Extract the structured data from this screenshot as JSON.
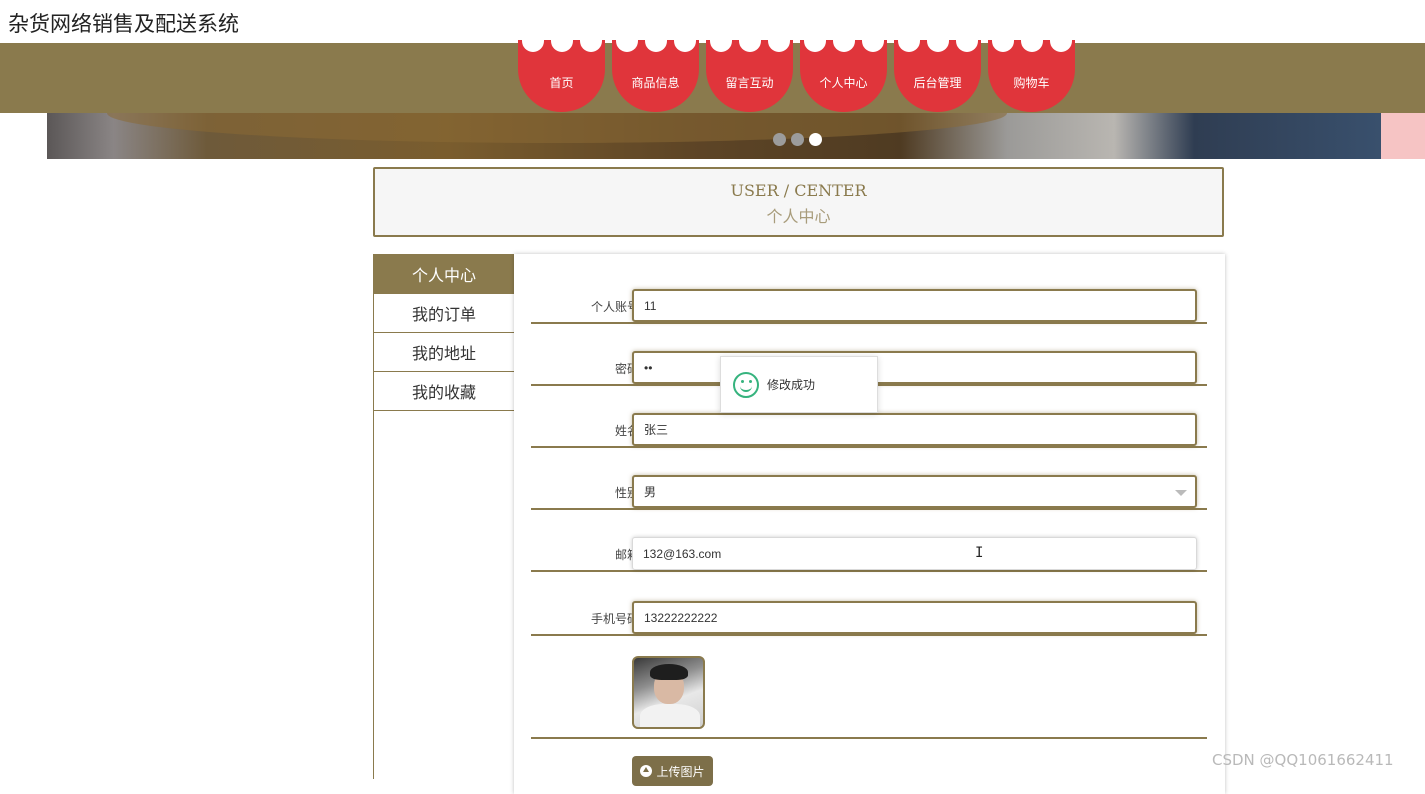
{
  "site": {
    "title": "杂货网络销售及配送系统"
  },
  "nav": {
    "items": [
      {
        "label": "首页"
      },
      {
        "label": "商品信息"
      },
      {
        "label": "留言互动"
      },
      {
        "label": "个人中心"
      },
      {
        "label": "后台管理"
      },
      {
        "label": "购物车"
      }
    ]
  },
  "carousel": {
    "active_index": 2,
    "count": 3
  },
  "center": {
    "title_en": "USER / CENTER",
    "title_cn": "个人中心"
  },
  "sidebar": {
    "items": [
      {
        "label": "个人中心",
        "active": true
      },
      {
        "label": "我的订单",
        "active": false
      },
      {
        "label": "我的地址",
        "active": false
      },
      {
        "label": "我的收藏",
        "active": false
      }
    ]
  },
  "form": {
    "account": {
      "label": "个人账号",
      "value": "11"
    },
    "password": {
      "label": "密码",
      "value": "••"
    },
    "name": {
      "label": "姓名",
      "value": "张三"
    },
    "gender": {
      "label": "性别",
      "value": "男"
    },
    "email": {
      "label": "邮箱",
      "value": "132@163.com"
    },
    "phone": {
      "label": "手机号码",
      "value": "13222222222"
    },
    "upload_label": "上传图片"
  },
  "toast": {
    "message": "修改成功"
  },
  "watermark": "CSDN @QQ1061662411",
  "colors": {
    "brand": "#8a7a4d",
    "nav_red": "#e0353b",
    "success": "#36b37e"
  }
}
